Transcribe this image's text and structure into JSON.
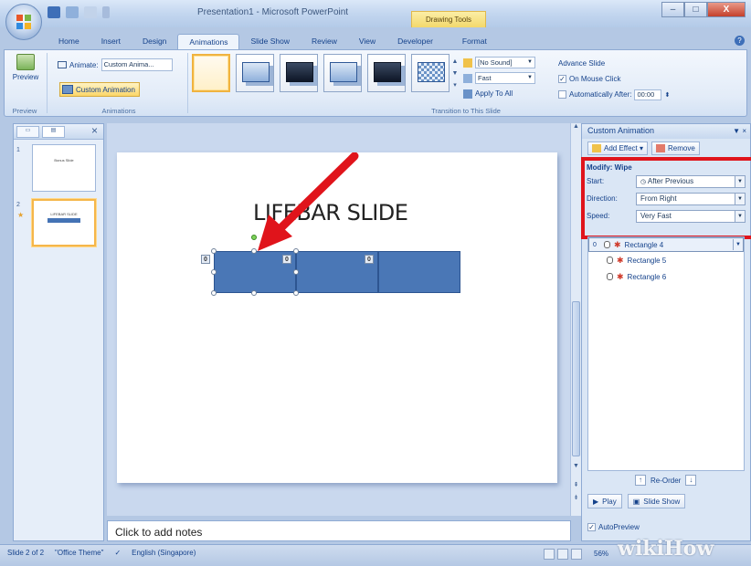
{
  "window": {
    "title": "Presentation1 - Microsoft PowerPoint",
    "context_tab": "Drawing Tools",
    "minimize": "–",
    "maximize": "□",
    "close": "X"
  },
  "ribbon_tabs": [
    "Home",
    "Insert",
    "Design",
    "Animations",
    "Slide Show",
    "Review",
    "View",
    "Developer",
    "Format"
  ],
  "active_tab": "Animations",
  "ribbon": {
    "preview_label": "Preview",
    "animate_label": "Animate:",
    "animate_value": "Custom Anima...",
    "custom_animation_label": "Custom Animation",
    "group_preview": "Preview",
    "group_animations": "Animations",
    "group_transition": "Transition to This Slide",
    "sound_value": "[No Sound]",
    "speed_value": "Fast",
    "apply_to_all": "Apply To All",
    "advance_slide": "Advance Slide",
    "on_mouse_click": "On Mouse Click",
    "auto_after": "Automatically After:",
    "auto_after_value": "00:00"
  },
  "slides_pane": {
    "slides": [
      {
        "number": "1",
        "title": "Bonus Slide"
      },
      {
        "number": "2",
        "title": "LIFEBAR SLIDE"
      }
    ]
  },
  "slide": {
    "title": "LIFEBAR SLIDE",
    "tags": [
      "0",
      "0",
      "0"
    ]
  },
  "notes_placeholder": "Click to add notes",
  "task_pane": {
    "title": "Custom Animation",
    "add_effect": "Add Effect ▾",
    "remove": "Remove",
    "modify_title": "Modify: Wipe",
    "start_label": "Start:",
    "start_value": "After Previous",
    "direction_label": "Direction:",
    "direction_value": "From Right",
    "speed_label": "Speed:",
    "speed_value": "Very Fast",
    "list": [
      {
        "num": "0",
        "name": "Rectangle 4"
      },
      {
        "num": "",
        "name": "Rectangle 5"
      },
      {
        "num": "",
        "name": "Rectangle 6"
      }
    ],
    "reorder": "Re-Order",
    "play": "Play",
    "slide_show": "Slide Show",
    "autopreview": "AutoPreview"
  },
  "status": {
    "slide_counter": "Slide 2 of 2",
    "theme": "\"Office Theme\"",
    "language": "English (Singapore)",
    "zoom": "56%"
  },
  "watermark": "wikiHow",
  "colors": {
    "accent_red": "#e0141b",
    "shape_blue": "#4a77b6",
    "ribbon_bg": "#e3ecf8"
  }
}
